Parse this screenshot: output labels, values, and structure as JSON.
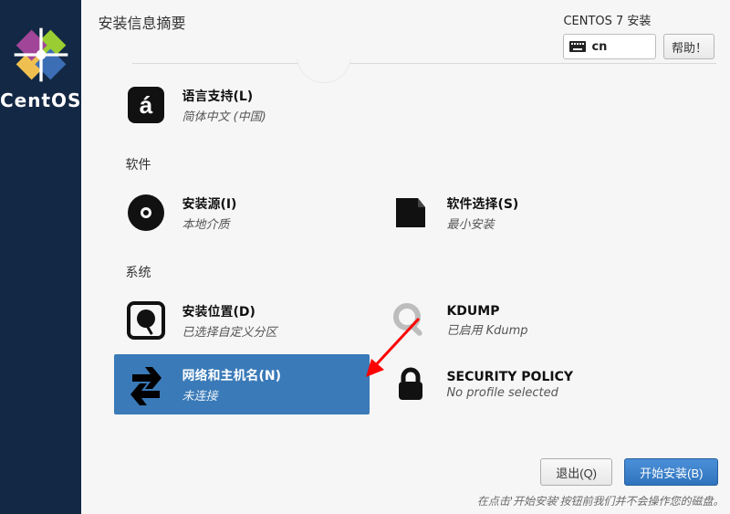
{
  "brand": "CentOS",
  "header": {
    "title": "安装信息摘要",
    "product": "CENTOS 7 安装",
    "lang_code": "cn",
    "help_label": "帮助！"
  },
  "sections": {
    "software_label": "软件",
    "system_label": "系统"
  },
  "spokes": {
    "lang": {
      "title": "语言支持(L)",
      "sub": "简体中文 (中国)"
    },
    "source": {
      "title": "安装源(I)",
      "sub": "本地介质"
    },
    "swsel": {
      "title": "软件选择(S)",
      "sub": "最小安装"
    },
    "dest": {
      "title": "安装位置(D)",
      "sub": "已选择自定义分区"
    },
    "kdump": {
      "title": "KDUMP",
      "sub": "已启用 Kdump"
    },
    "net": {
      "title": "网络和主机名(N)",
      "sub": "未连接"
    },
    "sec": {
      "title": "SECURITY POLICY",
      "sub": "No profile selected"
    }
  },
  "footer": {
    "quit": "退出(Q)",
    "begin": "开始安装(B)",
    "hint": "在点击'开始安装'按钮前我们并不会操作您的磁盘。"
  }
}
